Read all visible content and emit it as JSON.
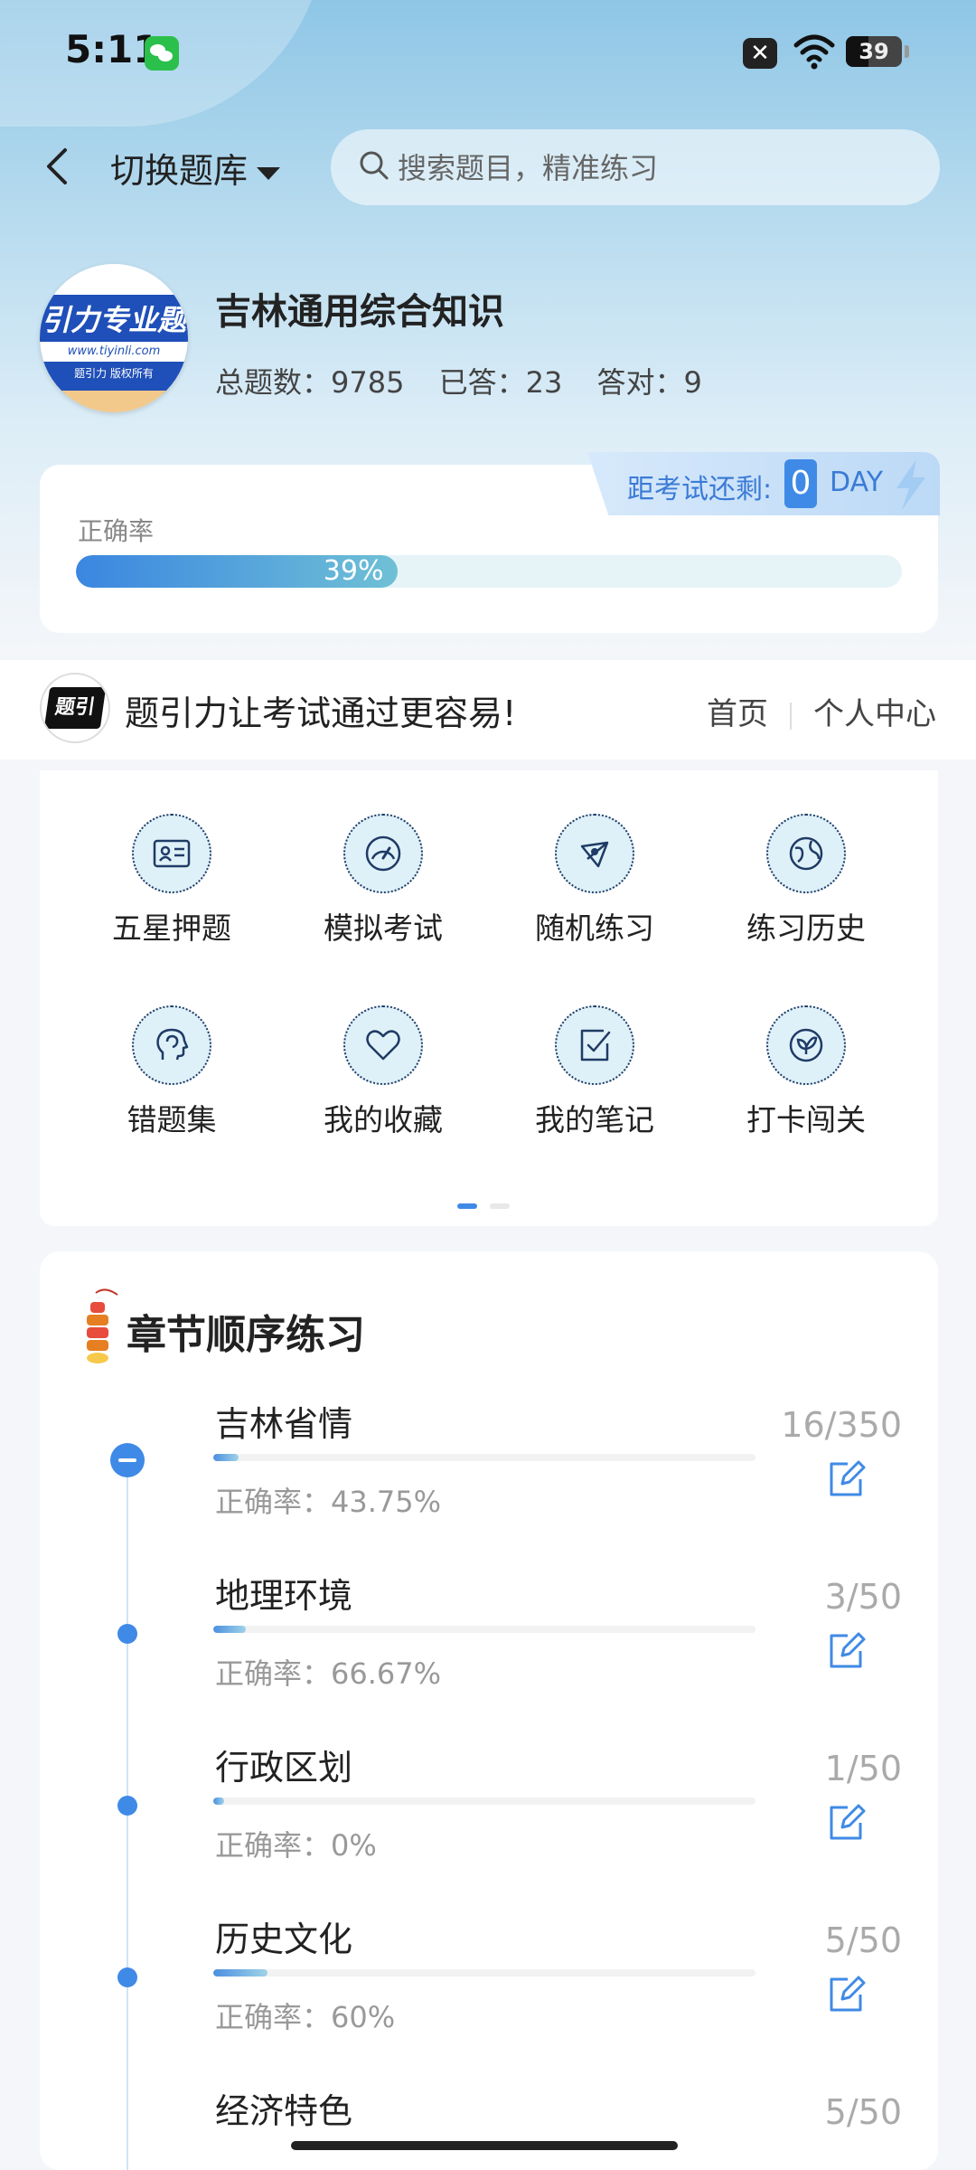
{
  "status_bar": {
    "time": "5:11",
    "battery": "39"
  },
  "header": {
    "switch_label": "切换题库",
    "search_placeholder": "搜索题目，精准练习"
  },
  "bank": {
    "logo": {
      "main": "引力专业题",
      "url": "www.tiyinli.com",
      "small": "题引力 版权所有"
    },
    "title": "吉林通用综合知识",
    "stats": [
      "总题数：9785",
      "已答：23",
      "答对：9"
    ]
  },
  "accuracy": {
    "label": "正确率",
    "percent_text": "39%",
    "percent": 39,
    "countdown_label": "距考试还剩:",
    "countdown_value": "0",
    "countdown_unit": "DAY"
  },
  "slogan": {
    "logo_text": "题引力",
    "text": "题引力让考试通过更容易!",
    "nav": [
      "首页",
      "个人中心"
    ]
  },
  "grid": [
    {
      "label": "五星押题",
      "icon": "id-card-icon"
    },
    {
      "label": "模拟考试",
      "icon": "speedometer-icon"
    },
    {
      "label": "随机练习",
      "icon": "network-icon"
    },
    {
      "label": "练习历史",
      "icon": "globe-icon"
    },
    {
      "label": "错题集",
      "icon": "head-icon"
    },
    {
      "label": "我的收藏",
      "icon": "heart-icon"
    },
    {
      "label": "我的笔记",
      "icon": "note-check-icon"
    },
    {
      "label": "打卡闯关",
      "icon": "leaf-badge-icon"
    }
  ],
  "chapters": {
    "title": "章节顺序练习",
    "items": [
      {
        "name": "吉林省情",
        "rate": "正确率：43.75%",
        "count": "16/350",
        "progress": 0.046
      },
      {
        "name": "地理环境",
        "rate": "正确率：66.67%",
        "count": "3/50",
        "progress": 0.06
      },
      {
        "name": "行政区划",
        "rate": "正确率：0%",
        "count": "1/50",
        "progress": 0.02
      },
      {
        "name": "历史文化",
        "rate": "正确率：60%",
        "count": "5/50",
        "progress": 0.1
      },
      {
        "name": "经济特色",
        "rate": "",
        "count": "5/50",
        "progress": 0.1
      }
    ]
  },
  "colors": {
    "accent": "#3f8ae6",
    "icon_bg": "#dff1f8",
    "icon_line": "#1f3b66"
  }
}
